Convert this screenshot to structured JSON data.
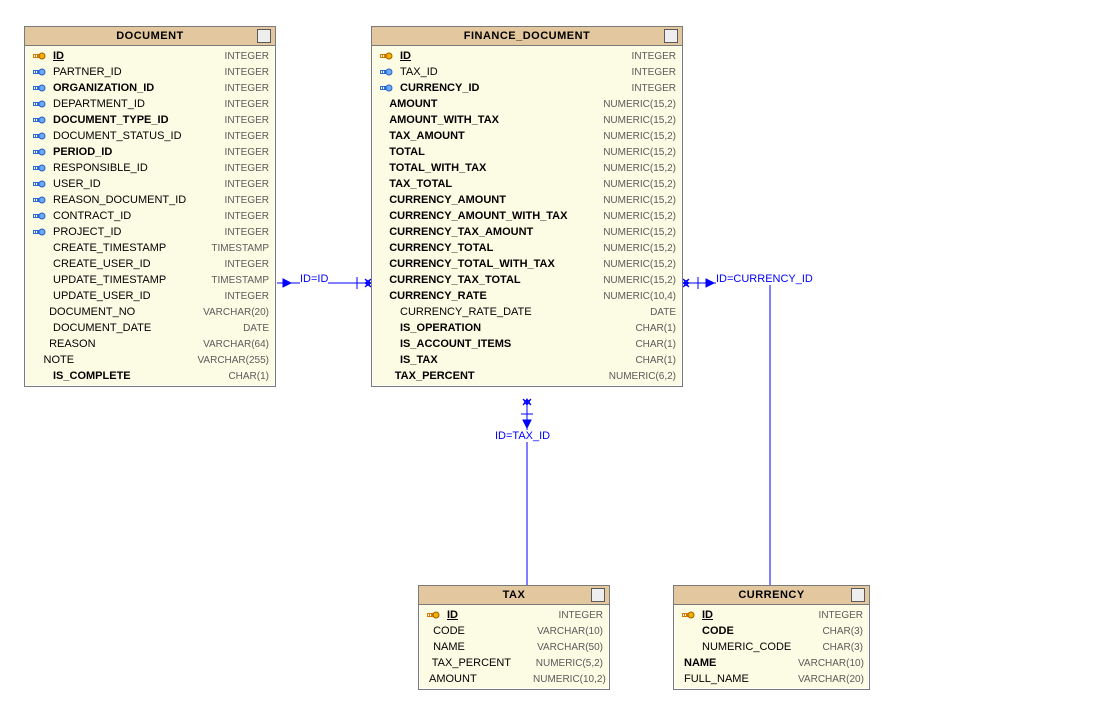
{
  "tables": {
    "document": {
      "title": "DOCUMENT",
      "cols": [
        {
          "n": "ID",
          "t": "INTEGER",
          "b": 1,
          "u": 1,
          "i": "pk"
        },
        {
          "n": "PARTNER_ID",
          "t": "INTEGER",
          "i": "fk"
        },
        {
          "n": "ORGANIZATION_ID",
          "t": "INTEGER",
          "b": 1,
          "i": "fk"
        },
        {
          "n": "DEPARTMENT_ID",
          "t": "INTEGER",
          "i": "fk"
        },
        {
          "n": "DOCUMENT_TYPE_ID",
          "t": "INTEGER",
          "b": 1,
          "i": "fk"
        },
        {
          "n": "DOCUMENT_STATUS_ID",
          "t": "INTEGER",
          "i": "fk"
        },
        {
          "n": "PERIOD_ID",
          "t": "INTEGER",
          "b": 1,
          "i": "fk"
        },
        {
          "n": "RESPONSIBLE_ID",
          "t": "INTEGER",
          "i": "fk"
        },
        {
          "n": "USER_ID",
          "t": "INTEGER",
          "i": "fk"
        },
        {
          "n": "REASON_DOCUMENT_ID",
          "t": "INTEGER",
          "i": "fk"
        },
        {
          "n": "CONTRACT_ID",
          "t": "INTEGER",
          "i": "fk"
        },
        {
          "n": "PROJECT_ID",
          "t": "INTEGER",
          "i": "fk"
        },
        {
          "n": "CREATE_TIMESTAMP",
          "t": "TIMESTAMP"
        },
        {
          "n": "CREATE_USER_ID",
          "t": "INTEGER"
        },
        {
          "n": "UPDATE_TIMESTAMP",
          "t": "TIMESTAMP"
        },
        {
          "n": "UPDATE_USER_ID",
          "t": "INTEGER"
        },
        {
          "n": "DOCUMENT_NO",
          "t": "VARCHAR(20)"
        },
        {
          "n": "DOCUMENT_DATE",
          "t": "DATE"
        },
        {
          "n": "REASON",
          "t": "VARCHAR(64)"
        },
        {
          "n": "NOTE",
          "t": "VARCHAR(255)"
        },
        {
          "n": "IS_COMPLETE",
          "t": "CHAR(1)",
          "b": 1
        }
      ]
    },
    "finance_document": {
      "title": "FINANCE_DOCUMENT",
      "cols": [
        {
          "n": "ID",
          "t": "INTEGER",
          "b": 1,
          "u": 1,
          "i": "pk"
        },
        {
          "n": "TAX_ID",
          "t": "INTEGER",
          "i": "fk"
        },
        {
          "n": "CURRENCY_ID",
          "t": "INTEGER",
          "b": 1,
          "i": "fk"
        },
        {
          "n": "AMOUNT",
          "t": "NUMERIC(15,2)",
          "b": 1
        },
        {
          "n": "AMOUNT_WITH_TAX",
          "t": "NUMERIC(15,2)",
          "b": 1
        },
        {
          "n": "TAX_AMOUNT",
          "t": "NUMERIC(15,2)",
          "b": 1
        },
        {
          "n": "TOTAL",
          "t": "NUMERIC(15,2)",
          "b": 1
        },
        {
          "n": "TOTAL_WITH_TAX",
          "t": "NUMERIC(15,2)",
          "b": 1
        },
        {
          "n": "TAX_TOTAL",
          "t": "NUMERIC(15,2)",
          "b": 1
        },
        {
          "n": "CURRENCY_AMOUNT",
          "t": "NUMERIC(15,2)",
          "b": 1
        },
        {
          "n": "CURRENCY_AMOUNT_WITH_TAX",
          "t": "NUMERIC(15,2)",
          "b": 1
        },
        {
          "n": "CURRENCY_TAX_AMOUNT",
          "t": "NUMERIC(15,2)",
          "b": 1
        },
        {
          "n": "CURRENCY_TOTAL",
          "t": "NUMERIC(15,2)",
          "b": 1
        },
        {
          "n": "CURRENCY_TOTAL_WITH_TAX",
          "t": "NUMERIC(15,2)",
          "b": 1
        },
        {
          "n": "CURRENCY_TAX_TOTAL",
          "t": "NUMERIC(15,2)",
          "b": 1
        },
        {
          "n": "CURRENCY_RATE",
          "t": "NUMERIC(10,4)",
          "b": 1
        },
        {
          "n": "CURRENCY_RATE_DATE",
          "t": "DATE"
        },
        {
          "n": "IS_OPERATION",
          "t": "CHAR(1)",
          "b": 1
        },
        {
          "n": "IS_ACCOUNT_ITEMS",
          "t": "CHAR(1)",
          "b": 1
        },
        {
          "n": "IS_TAX",
          "t": "CHAR(1)",
          "b": 1
        },
        {
          "n": "TAX_PERCENT",
          "t": "NUMERIC(6,2)",
          "b": 1
        }
      ]
    },
    "tax": {
      "title": "TAX",
      "cols": [
        {
          "n": "ID",
          "t": "INTEGER",
          "b": 1,
          "u": 1,
          "i": "pk"
        },
        {
          "n": "CODE",
          "t": "VARCHAR(10)"
        },
        {
          "n": "NAME",
          "t": "VARCHAR(50)"
        },
        {
          "n": "TAX_PERCENT",
          "t": "NUMERIC(5,2)"
        },
        {
          "n": "AMOUNT",
          "t": "NUMERIC(10,2)"
        }
      ]
    },
    "currency": {
      "title": "CURRENCY",
      "cols": [
        {
          "n": "ID",
          "t": "INTEGER",
          "b": 1,
          "u": 1,
          "i": "pk"
        },
        {
          "n": "CODE",
          "t": "CHAR(3)",
          "b": 1
        },
        {
          "n": "NUMERIC_CODE",
          "t": "CHAR(3)"
        },
        {
          "n": "NAME",
          "t": "VARCHAR(10)",
          "b": 1
        },
        {
          "n": "FULL_NAME",
          "t": "VARCHAR(20)"
        }
      ]
    }
  },
  "rel_labels": {
    "doc_fd": "ID=ID",
    "fd_cur": "ID=CURRENCY_ID",
    "fd_tax": "ID=TAX_ID"
  }
}
